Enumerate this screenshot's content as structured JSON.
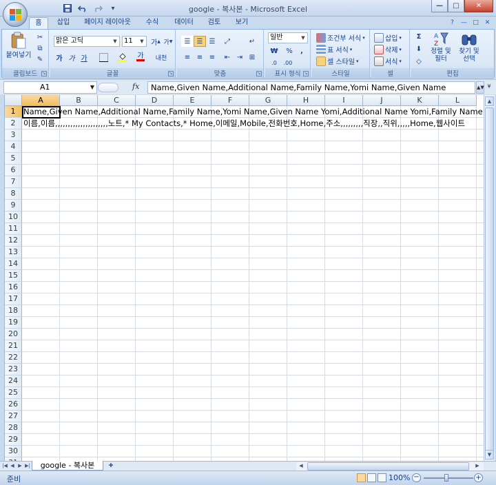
{
  "window": {
    "title": "google - 복사본 - Microsoft Excel",
    "buttons": {
      "minimize": "—",
      "maximize": "□",
      "close": "✕"
    }
  },
  "qat": {
    "save_icon": "save-icon",
    "undo_icon": "undo-icon",
    "redo_icon": "redo-icon",
    "customize_icon": "chevron-down-icon"
  },
  "tabs": [
    "홈",
    "삽입",
    "페이지 레이아웃",
    "수식",
    "데이터",
    "검토",
    "보기"
  ],
  "active_tab": "홈",
  "ribbon": {
    "clipboard": {
      "label": "클립보드",
      "paste": "붙여넣기"
    },
    "font": {
      "label": "글꼴",
      "name": "맑은 고딕",
      "size": "11",
      "grow": "가",
      "shrink": "가",
      "bold": "가",
      "italic": "가",
      "underline": "가",
      "font_color": "가",
      "phonetic": "내천"
    },
    "alignment": {
      "label": "맞춤"
    },
    "number": {
      "label": "표시 형식",
      "format": "일반",
      "currency": "₩",
      "percent": "%",
      "comma": ","
    },
    "styles": {
      "label": "스타일",
      "conditional": "조건부 서식",
      "table": "표 서식",
      "cell": "셀 스타일"
    },
    "cells": {
      "label": "셀",
      "insert": "삽입",
      "delete": "삭제",
      "format": "서식"
    },
    "editing": {
      "label": "편집",
      "sort": "정렬 및 필터",
      "find": "찾기 및 선택",
      "sort_line1": "정렬 및",
      "sort_line2": "필터",
      "find_line1": "찾기 및",
      "find_line2": "선택"
    }
  },
  "formula_bar": {
    "name_box": "A1",
    "fx": "fx",
    "content": "Name,Given Name,Additional Name,Family Name,Yomi Name,Given Name"
  },
  "sheet": {
    "columns": [
      "A",
      "B",
      "C",
      "D",
      "E",
      "F",
      "G",
      "H",
      "I",
      "J",
      "K",
      "L"
    ],
    "selected_column": "A",
    "selected_row": 1,
    "row_count": 31,
    "rows": {
      "1": "Name,Given Name,Additional Name,Family Name,Yomi Name,Given Name Yomi,Additional Name Yomi,Family Name Yomi,Name",
      "2": "이름,이름,,,,,,,,,,,,,,,,,,,,,노트,* My Contacts,* Home,이메일,Mobile,전화번호,Home,주소,,,,,,,,,직장,,직위,,,,,Home,웹사이트"
    }
  },
  "sheet_tabs": {
    "active": "google - 복사본"
  },
  "status": {
    "ready": "준비",
    "zoom": "100%"
  }
}
